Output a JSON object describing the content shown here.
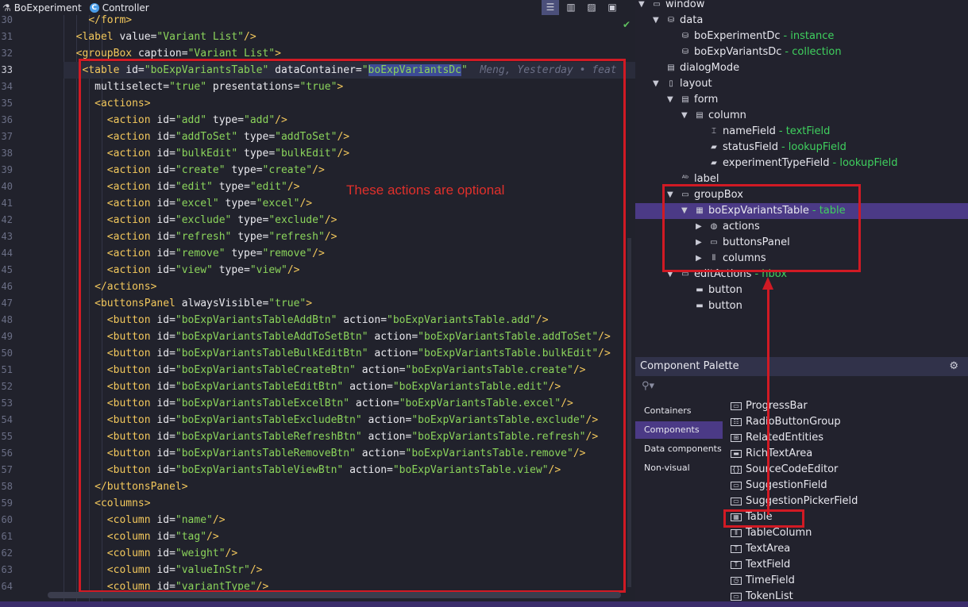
{
  "breadcrumb": {
    "file": "BoExperiment",
    "controller": "Controller"
  },
  "editor": {
    "annotation": "These actions are optional",
    "line_numbers": [
      "30",
      "31",
      "32",
      "33",
      "34",
      "35",
      "36",
      "37",
      "38",
      "39",
      "40",
      "41",
      "42",
      "43",
      "44",
      "45",
      "46",
      "47",
      "48",
      "49",
      "50",
      "51",
      "52",
      "53",
      "54",
      "55",
      "56",
      "57",
      "58",
      "59",
      "60",
      "61",
      "62",
      "63",
      "64"
    ],
    "current_line": "33",
    "blame": "Meng, Yesterday • feat"
  },
  "tree": {
    "window": "window",
    "data": "data",
    "boExperimentDc": "boExperimentDc",
    "boExperimentDc_type": "- instance",
    "boExpVariantsDc": "boExpVariantsDc",
    "boExpVariantsDc_type": "- collection",
    "dialogMode": "dialogMode",
    "layout": "layout",
    "form": "form",
    "column": "column",
    "nameField": "nameField",
    "nameField_type": "- textField",
    "statusField": "statusField",
    "statusField_type": "- lookupField",
    "experimentTypeField": "experimentTypeField",
    "experimentTypeField_type": "- lookupField",
    "label": "label",
    "groupBox": "groupBox",
    "boExpVariantsTable": "boExpVariantsTable",
    "boExpVariantsTable_type": "- table",
    "actions": "actions",
    "buttonsPanel": "buttonsPanel",
    "columns": "columns",
    "editActions": "editActions",
    "editActions_type": "- hbox",
    "button1": "button",
    "button2": "button"
  },
  "palette": {
    "title": "Component Palette",
    "categories": [
      "Containers",
      "Components",
      "Data components",
      "Non-visual"
    ],
    "items": [
      "ProgressBar",
      "RadioButtonGroup",
      "RelatedEntities",
      "RichTextArea",
      "SourceCodeEditor",
      "SuggestionField",
      "SuggestionPickerField",
      "Table",
      "TableColumn",
      "TextArea",
      "TextField",
      "TimeField",
      "TokenList"
    ]
  }
}
